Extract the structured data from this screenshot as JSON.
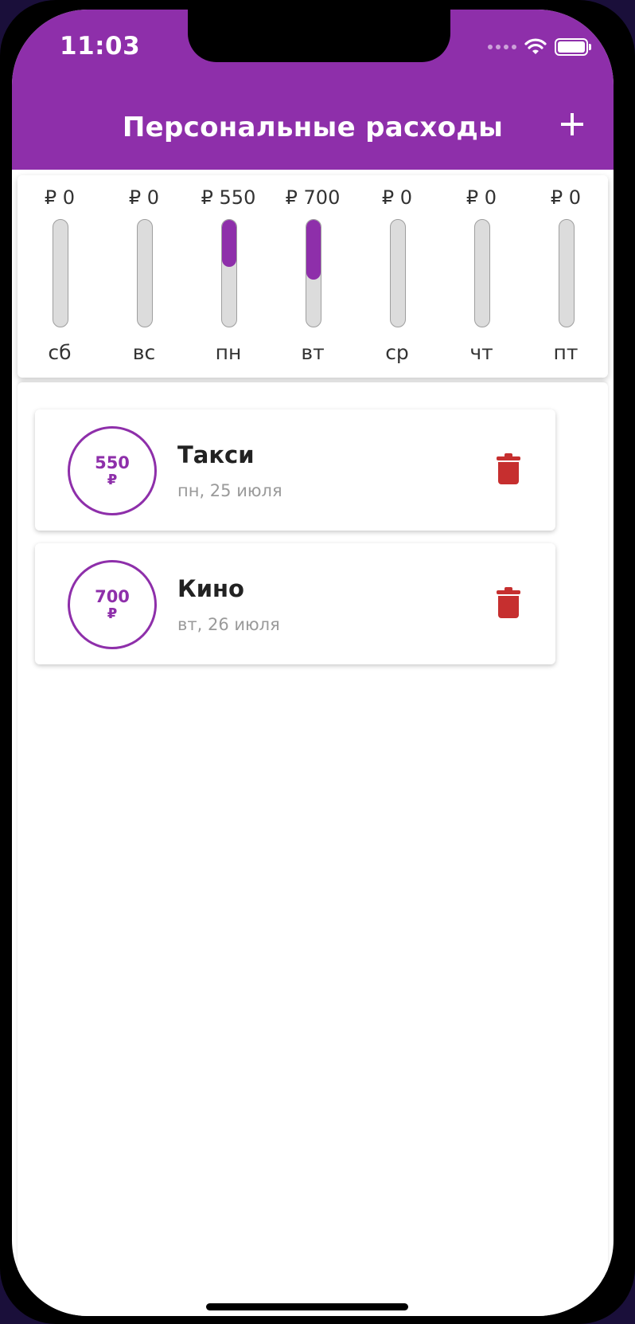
{
  "status_bar": {
    "time": "11:03"
  },
  "app_bar": {
    "title": "Персональные расходы",
    "add_icon": "plus-icon"
  },
  "colors": {
    "primary": "#8e2faa",
    "delete": "#c62f2f",
    "bar_track": "#dcdcdc"
  },
  "chart": {
    "days": [
      {
        "day": "сб",
        "amount_label": "₽ 0",
        "amount": 0,
        "fill": 0
      },
      {
        "day": "вс",
        "amount_label": "₽ 0",
        "amount": 0,
        "fill": 0
      },
      {
        "day": "пн",
        "amount_label": "₽ 550",
        "amount": 550,
        "fill": 0.44
      },
      {
        "day": "вт",
        "amount_label": "₽ 700",
        "amount": 700,
        "fill": 0.56
      },
      {
        "day": "ср",
        "amount_label": "₽ 0",
        "amount": 0,
        "fill": 0
      },
      {
        "day": "чт",
        "amount_label": "₽ 0",
        "amount": 0,
        "fill": 0
      },
      {
        "day": "пт",
        "amount_label": "₽ 0",
        "amount": 0,
        "fill": 0
      }
    ]
  },
  "transactions": [
    {
      "amount": "550",
      "currency": "₽",
      "title": "Такси",
      "date": "пн, 25 июля",
      "delete_icon": "trash-icon"
    },
    {
      "amount": "700",
      "currency": "₽",
      "title": "Кино",
      "date": "вт, 26 июля",
      "delete_icon": "trash-icon"
    }
  ]
}
